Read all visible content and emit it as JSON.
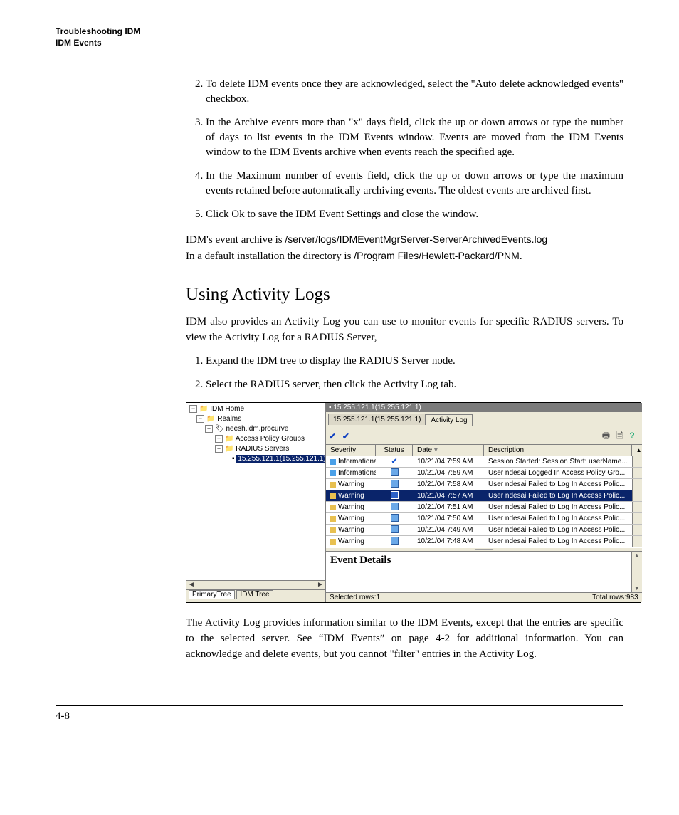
{
  "header": {
    "line1": "Troubleshooting IDM",
    "line2": "IDM Events"
  },
  "steps1": [
    {
      "n": "2.",
      "t": "To delete IDM events once they are acknowledged, select the \"Auto delete acknowledged events\" checkbox."
    },
    {
      "n": "3.",
      "t": "In the Archive events more than \"x\" days field, click the up or down arrows or type the number of days to list events in the IDM Events window. Events are moved from the IDM Events window to the IDM Events archive when events reach the specified age."
    },
    {
      "n": "4.",
      "t": "In the Maximum number of events field, click the up or down arrows or type the maximum events retained before automatically archiving events. The oldest events are archived first."
    },
    {
      "n": "5.",
      "t": "Click Ok to save the IDM Event Settings and close the window."
    }
  ],
  "archive_p1a": "IDM's event archive is ",
  "archive_path": "/server/logs/IDMEventMgrServer-ServerArchivedEvents.log",
  "archive_p2a": "In a default installation the directory is ",
  "archive_dir": "/Program Files/Hewlett-Packard/PNM",
  "section_title": "Using Activity Logs",
  "p_intro": "IDM also provides an Activity Log you can use to monitor events for specific RADIUS servers. To view the Activity Log for a RADIUS Server,",
  "steps2": [
    {
      "n": "1.",
      "t": "Expand the IDM tree to display the RADIUS Server node."
    },
    {
      "n": "2.",
      "t": "Select the RADIUS server, then click the Activity Log tab."
    }
  ],
  "tree": {
    "n0": "IDM Home",
    "n1": "Realms",
    "n2": "neesh.idm.procurve",
    "n3": "Access Policy Groups",
    "n4": "RADIUS Servers",
    "n5": "15.255.121.1(15.255.121.1)"
  },
  "tree_tabs": {
    "a": "PrimaryTree",
    "b": "IDM Tree"
  },
  "main": {
    "title": "15.255.121.1(15.255.121.1)",
    "tab_back": "15.255.121.1(15.255.121.1)",
    "tab_front": "Activity Log",
    "cols": {
      "sev": "Severity",
      "stat": "Status",
      "date": "Date",
      "desc": "Description"
    },
    "rows": [
      {
        "sev": "Informational",
        "sevc": "info",
        "stat": "check",
        "date": "10/21/04 7:59 AM",
        "desc": "Session Started: Session Start: userName...",
        "sel": false
      },
      {
        "sev": "Informational",
        "sevc": "info",
        "stat": "sq",
        "date": "10/21/04 7:59 AM",
        "desc": "User ndesai Logged In Access Policy Gro...",
        "sel": false
      },
      {
        "sev": "Warning",
        "sevc": "warn",
        "stat": "sq",
        "date": "10/21/04 7:58 AM",
        "desc": "User ndesai Failed to Log In Access Polic...",
        "sel": false
      },
      {
        "sev": "Warning",
        "sevc": "warn",
        "stat": "sq",
        "date": "10/21/04 7:57 AM",
        "desc": "User ndesai Failed to Log In Access Polic...",
        "sel": true
      },
      {
        "sev": "Warning",
        "sevc": "warn",
        "stat": "sq",
        "date": "10/21/04 7:51 AM",
        "desc": "User ndesai Failed to Log In Access Polic...",
        "sel": false
      },
      {
        "sev": "Warning",
        "sevc": "warn",
        "stat": "sq",
        "date": "10/21/04 7:50 AM",
        "desc": "User ndesai Failed to Log In Access Polic...",
        "sel": false
      },
      {
        "sev": "Warning",
        "sevc": "warn",
        "stat": "sq",
        "date": "10/21/04 7:49 AM",
        "desc": "User ndesai Failed to Log In Access Polic...",
        "sel": false
      },
      {
        "sev": "Warning",
        "sevc": "warn",
        "stat": "sq",
        "date": "10/21/04 7:48 AM",
        "desc": "User ndesai Failed to Log In Access Polic...",
        "sel": false
      }
    ],
    "details_title": "Event Details",
    "status_left": "Selected rows:1",
    "status_right": "Total rows:983"
  },
  "p_after": "The Activity Log provides information similar to the IDM Events, except that the entries are specific to the selected server. See “IDM Events” on page 4-2 for additional information. You can acknowledge and delete events, but you cannot \"filter\" entries in the Activity Log.",
  "pagenum": "4-8"
}
